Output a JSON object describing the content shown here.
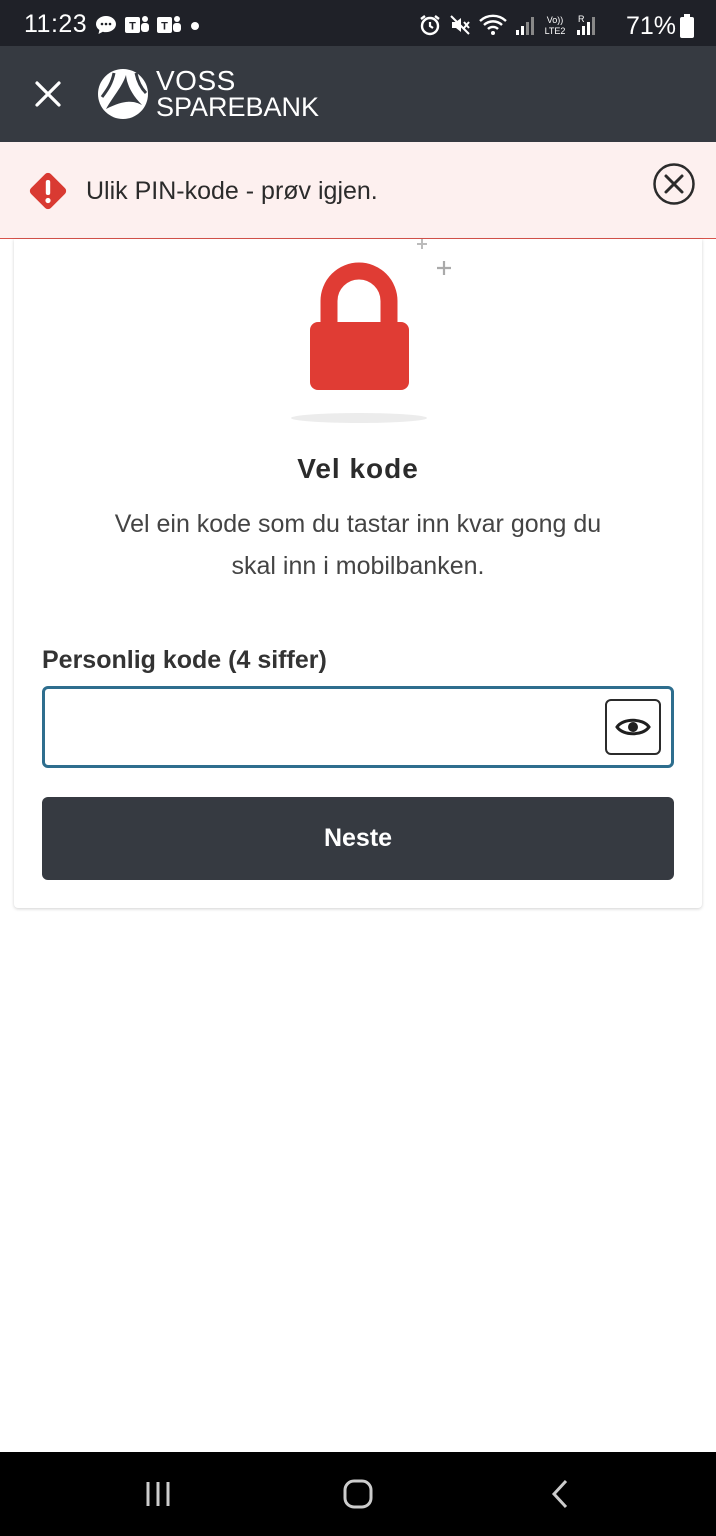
{
  "status_bar": {
    "time": "11:23",
    "battery": "71%"
  },
  "header": {
    "logo_line1": "VOSS",
    "logo_line2": "SPAREBANK"
  },
  "error_banner": {
    "message": "Ulik PIN-kode - prøv igjen."
  },
  "card": {
    "title": "Vel kode",
    "description": "Vel ein kode som du tastar inn kvar gong du skal inn i mobilbanken.",
    "field_label": "Personlig kode (4 siffer)",
    "pin_value": "",
    "next_label": "Neste"
  },
  "colors": {
    "header_bg": "#363a41",
    "error_bg": "#fdf0ef",
    "error_red": "#d93a32",
    "lock_red": "#e03c34",
    "input_border": "#2e6e8e"
  },
  "icons": {
    "close": "close-icon",
    "error": "warning-icon",
    "dismiss": "close-circle-icon",
    "lock": "lock-icon",
    "visibility": "eye-icon"
  }
}
